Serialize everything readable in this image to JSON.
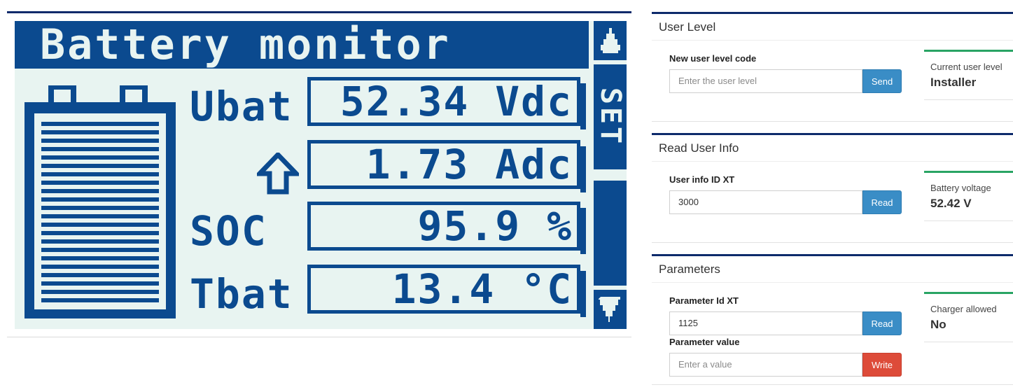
{
  "lcd": {
    "title": "Battery monitor",
    "set_label": "SET",
    "rows": [
      {
        "label": "Ubat",
        "value": "52.34 Vdc"
      },
      {
        "label": "",
        "value": "1.73 Adc"
      },
      {
        "label": "SOC",
        "value": "95.9 %"
      },
      {
        "label": "Tbat",
        "value": "13.4 °C"
      }
    ],
    "icons": {
      "up": "triangle-up-icon",
      "down": "triangle-down-icon",
      "current_direction": "arrow-up-icon",
      "battery": "battery-icon"
    },
    "colors": {
      "foreground": "#0b4a8f",
      "background": "#e8f4f1"
    }
  },
  "user_level": {
    "heading": "User Level",
    "field_label": "New user level code",
    "placeholder": "Enter the user level",
    "button": "Send",
    "card_label": "Current user level",
    "card_value": "Installer"
  },
  "user_info": {
    "heading": "Read User Info",
    "field_label": "User info ID XT",
    "value": "3000",
    "button": "Read",
    "card_label": "Battery voltage",
    "card_value": "52.42 V"
  },
  "parameters": {
    "heading": "Parameters",
    "id_label": "Parameter Id XT",
    "id_value": "1125",
    "read_button": "Read",
    "value_label": "Parameter value",
    "value_placeholder": "Enter a value",
    "write_button": "Write",
    "card_label": "Charger allowed",
    "card_value": "No"
  },
  "colors": {
    "panel_border": "#0d2a6b",
    "accent_green": "#29a464",
    "button_blue": "#3a8dc6",
    "button_red": "#dd4b39"
  }
}
